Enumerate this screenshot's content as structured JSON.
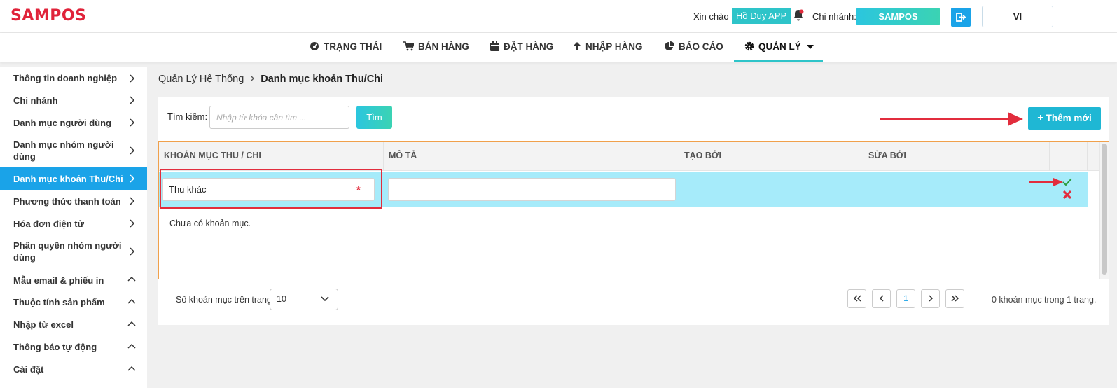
{
  "header": {
    "logo": "SAMPOS",
    "greeting": "Xin chào",
    "user_name": "Hồ Duy APP",
    "branch_label": "Chi nhánh:",
    "branch_name": "SAMPOS",
    "language": "VI"
  },
  "nav": {
    "items": [
      {
        "label": "TRẠNG THÁI",
        "icon": "dashboard-icon"
      },
      {
        "label": "BÁN HÀNG",
        "icon": "cart-icon"
      },
      {
        "label": "ĐẶT HÀNG",
        "icon": "calendar-icon"
      },
      {
        "label": "NHẬP HÀNG",
        "icon": "arrow-up-icon"
      },
      {
        "label": "BÁO CÁO",
        "icon": "pie-chart-icon"
      },
      {
        "label": "QUẢN LÝ",
        "icon": "gear-icon",
        "active": true
      }
    ]
  },
  "sidebar": {
    "items": [
      {
        "label": "Thông tin doanh nghiệp"
      },
      {
        "label": "Chi nhánh"
      },
      {
        "label": "Danh mục người dùng"
      },
      {
        "label": "Danh mục nhóm người dùng"
      },
      {
        "label": "Danh mục khoản Thu/Chi",
        "active": true
      },
      {
        "label": "Phương thức thanh toán"
      },
      {
        "label": "Hóa đơn điện tử"
      },
      {
        "label": "Phân quyền nhóm người dùng"
      },
      {
        "label": "Mẫu email & phiếu in"
      },
      {
        "label": "Thuộc tính sản phẩm"
      },
      {
        "label": "Nhập từ excel"
      },
      {
        "label": "Thông báo tự động"
      },
      {
        "label": "Cài đặt"
      }
    ]
  },
  "breadcrumb": {
    "parent": "Quản Lý Hệ Thống",
    "current": "Danh mục khoản Thu/Chi"
  },
  "search": {
    "label": "Tìm kiếm:",
    "placeholder": "Nhập từ khóa cần tìm ...",
    "button": "Tìm"
  },
  "add_button": "Thêm mới",
  "table": {
    "columns": [
      "KHOẢN MỤC THU / CHI",
      "MÔ TẢ",
      "TẠO BỞI",
      "SỬA BỞI"
    ],
    "edit_row": {
      "name_value": "Thu khác",
      "required_mark": "*",
      "description_value": ""
    },
    "empty_message": "Chưa có khoản mục."
  },
  "pagination": {
    "page_size_label": "Số khoản mục trên trang",
    "page_size": "10",
    "current_page": "1",
    "info": "0 khoản mục trong 1 trang."
  },
  "colors": {
    "brand": "#e0233a",
    "accent": "#1aa3e8",
    "teal": "#2ec4c9",
    "annotation": "#e22d3d"
  }
}
